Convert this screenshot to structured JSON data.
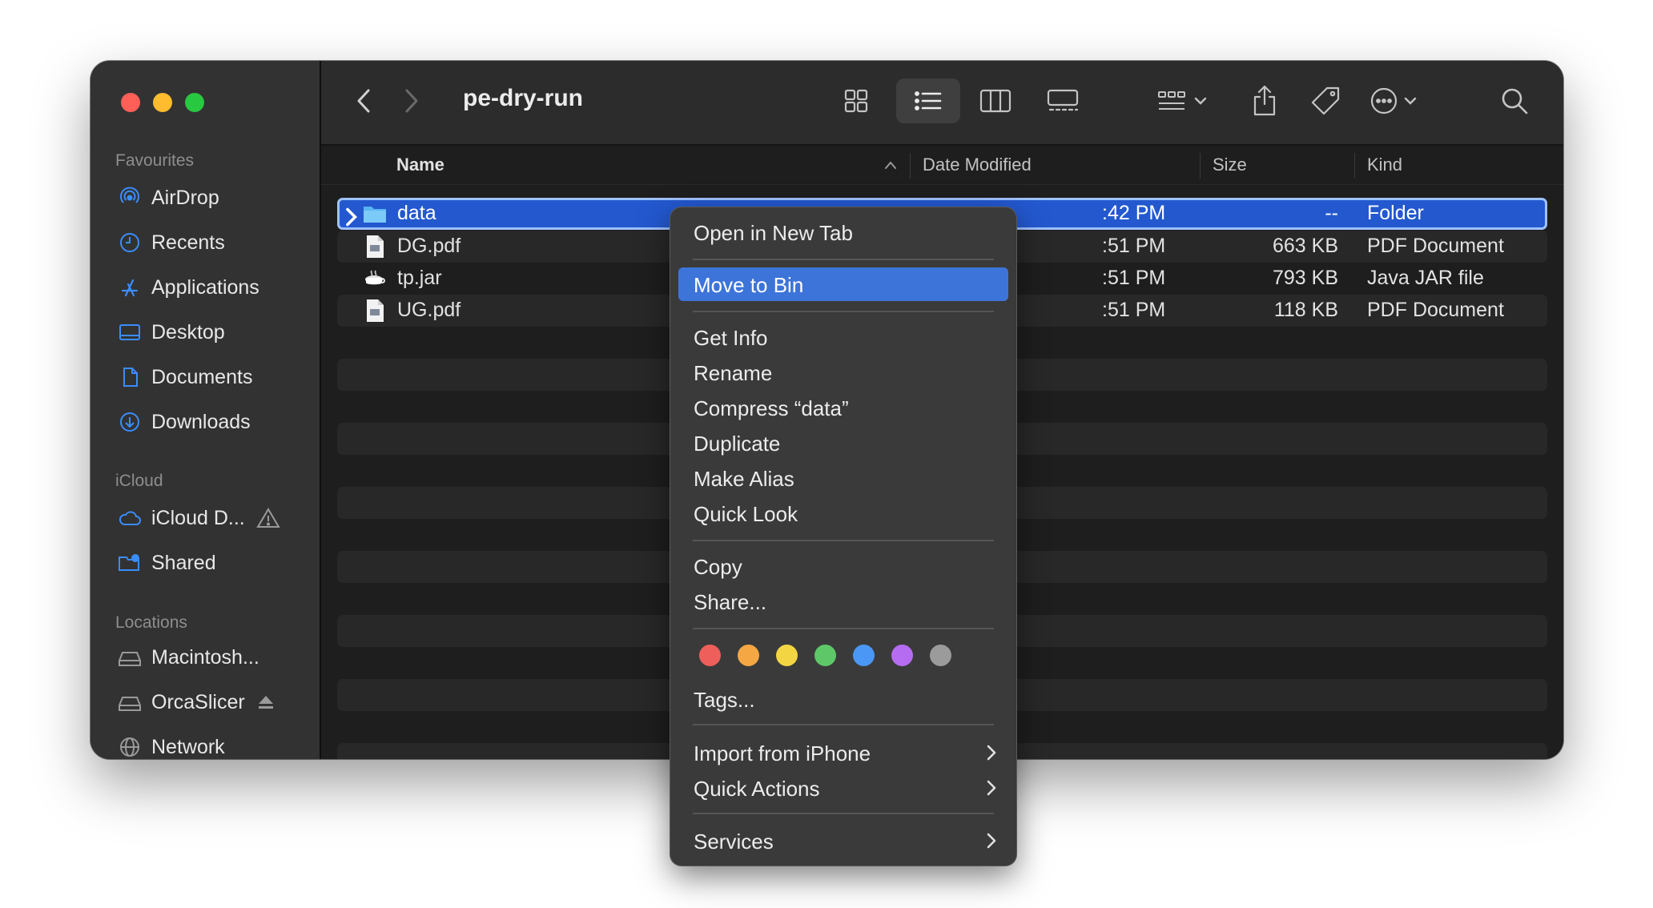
{
  "window": {
    "title": "pe-dry-run"
  },
  "sidebar": {
    "sections": [
      {
        "header": "Favourites",
        "items": [
          {
            "label": "AirDrop",
            "icon": "airdrop-icon"
          },
          {
            "label": "Recents",
            "icon": "clock-icon"
          },
          {
            "label": "Applications",
            "icon": "applications-icon"
          },
          {
            "label": "Desktop",
            "icon": "desktop-icon"
          },
          {
            "label": "Documents",
            "icon": "document-icon"
          },
          {
            "label": "Downloads",
            "icon": "download-icon"
          }
        ]
      },
      {
        "header": "iCloud",
        "items": [
          {
            "label": "iCloud D...",
            "icon": "cloud-icon",
            "badge": "warning-icon"
          },
          {
            "label": "Shared",
            "icon": "shared-folder-icon"
          }
        ]
      },
      {
        "header": "Locations",
        "items": [
          {
            "label": "Macintosh...",
            "icon": "disk-icon"
          },
          {
            "label": "OrcaSlicer",
            "icon": "disk-icon",
            "badge": "eject-icon"
          },
          {
            "label": "Network",
            "icon": "network-icon"
          }
        ]
      }
    ]
  },
  "columns": {
    "name": "Name",
    "date": "Date Modified",
    "size": "Size",
    "kind": "Kind"
  },
  "files": [
    {
      "name": "data",
      "date": ":42 PM",
      "size": "--",
      "kind": "Folder",
      "icon": "folder-icon",
      "selected": true
    },
    {
      "name": "DG.pdf",
      "date": ":51 PM",
      "size": "663 KB",
      "kind": "PDF Document",
      "icon": "pdf-file-icon"
    },
    {
      "name": "tp.jar",
      "date": ":51 PM",
      "size": "793 KB",
      "kind": "Java JAR file",
      "icon": "jar-file-icon"
    },
    {
      "name": "UG.pdf",
      "date": ":51 PM",
      "size": "118 KB",
      "kind": "PDF Document",
      "icon": "pdf-file-icon"
    }
  ],
  "context_menu": {
    "open_new_tab": "Open in New Tab",
    "move_to_bin": "Move to Bin",
    "get_info": "Get Info",
    "rename": "Rename",
    "compress": "Compress “data”",
    "duplicate": "Duplicate",
    "make_alias": "Make Alias",
    "quick_look": "Quick Look",
    "copy": "Copy",
    "share": "Share...",
    "tags": "Tags...",
    "import_iphone": "Import from iPhone",
    "quick_actions": "Quick Actions",
    "services": "Services",
    "tag_colors": [
      "#ee5f5b",
      "#f5a744",
      "#f3d543",
      "#5ec868",
      "#4a97f5",
      "#b66cf0",
      "#9b9b9b"
    ]
  },
  "colors": {
    "accent": "#2358cf",
    "menu_highlight": "#3d74d9",
    "sidebar_icon": "#3a8dfe"
  }
}
